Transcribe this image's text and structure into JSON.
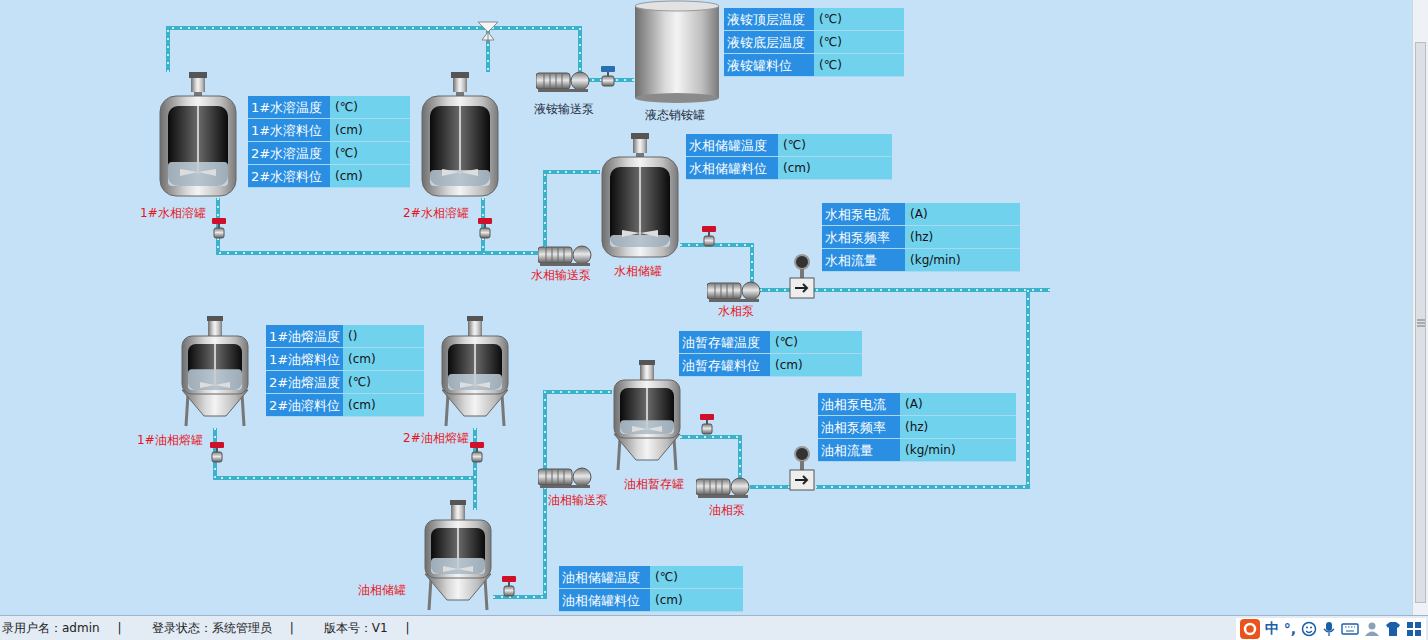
{
  "tanks": [
    {
      "label": "1#水相溶罐",
      "kind": "vertical",
      "level": 0.3,
      "color": "#e8141c"
    },
    {
      "label": "2#水相溶罐",
      "kind": "vertical",
      "level": 0.2,
      "color": "#e8141c"
    },
    {
      "label": "水相储罐",
      "kind": "vertical",
      "level": 0.15,
      "color": "#e8141c"
    },
    {
      "label": "液态销铵罐",
      "kind": "drum",
      "color": "#1f2d3d"
    },
    {
      "label": "1#油相熔罐",
      "kind": "conical",
      "level": 0.45,
      "color": "#e8141c"
    },
    {
      "label": "2#油相熔罐",
      "kind": "conical",
      "level": 0.35,
      "color": "#e8141c"
    },
    {
      "label": "油相暂存罐",
      "kind": "conical",
      "level": 0.3,
      "color": "#e8141c"
    },
    {
      "label": "油相储罐",
      "kind": "conical",
      "level": 0.35,
      "color": "#e8141c"
    }
  ],
  "pumps": [
    {
      "label": "液铵输送泵",
      "color": "#1f2d3d"
    },
    {
      "label": "水相输送泵",
      "color": "#e8141c"
    },
    {
      "label": "水相泵",
      "color": "#e8141c"
    },
    {
      "label": "油相输送泵",
      "color": "#e8141c"
    },
    {
      "label": "油相泵",
      "color": "#e8141c"
    }
  ],
  "panels": [
    {
      "rows": [
        {
          "label": "液铵顶层温度",
          "unit": "(℃)"
        },
        {
          "label": "液铵底层温度",
          "unit": "(℃)"
        },
        {
          "label": "液铵罐料位",
          "unit": "(℃)"
        }
      ]
    },
    {
      "rows": [
        {
          "label": "1#水溶温度",
          "unit": "(℃)"
        },
        {
          "label": "1#水溶料位",
          "unit": "(cm)"
        },
        {
          "label": "2#水溶温度",
          "unit": "(℃)"
        },
        {
          "label": "2#水溶料位",
          "unit": "(cm)"
        }
      ]
    },
    {
      "rows": [
        {
          "label": "水相储罐温度",
          "unit": "(℃)"
        },
        {
          "label": "水相储罐料位",
          "unit": "(cm)"
        }
      ]
    },
    {
      "rows": [
        {
          "label": "水相泵电流",
          "unit": "(A)"
        },
        {
          "label": "水相泵频率",
          "unit": "(hz)"
        },
        {
          "label": "水相流量",
          "unit": "(kg/min)"
        }
      ]
    },
    {
      "rows": [
        {
          "label": "1#油熔温度",
          "unit": "()"
        },
        {
          "label": "1#油熔料位",
          "unit": "(cm)"
        },
        {
          "label": "2#油熔温度",
          "unit": "(℃)"
        },
        {
          "label": "2#油溶料位",
          "unit": "(cm)"
        }
      ]
    },
    {
      "rows": [
        {
          "label": "油暂存罐温度",
          "unit": "(℃)"
        },
        {
          "label": "油暂存罐料位",
          "unit": "(cm)"
        }
      ]
    },
    {
      "rows": [
        {
          "label": "油相泵电流",
          "unit": "(A)"
        },
        {
          "label": "油相泵频率",
          "unit": "(hz)"
        },
        {
          "label": "油相流量",
          "unit": "(kg/min)"
        }
      ]
    },
    {
      "rows": [
        {
          "label": "油相储罐温度",
          "unit": "(℃)"
        },
        {
          "label": "油相储罐料位",
          "unit": "(cm)"
        }
      ]
    }
  ],
  "status_bar": {
    "separator": "|",
    "items": [
      "录用户名：admin",
      "登录状态：系统管理员",
      "版本号：V1"
    ]
  },
  "ime_toolbar": {
    "items": [
      "中",
      "°,"
    ]
  }
}
